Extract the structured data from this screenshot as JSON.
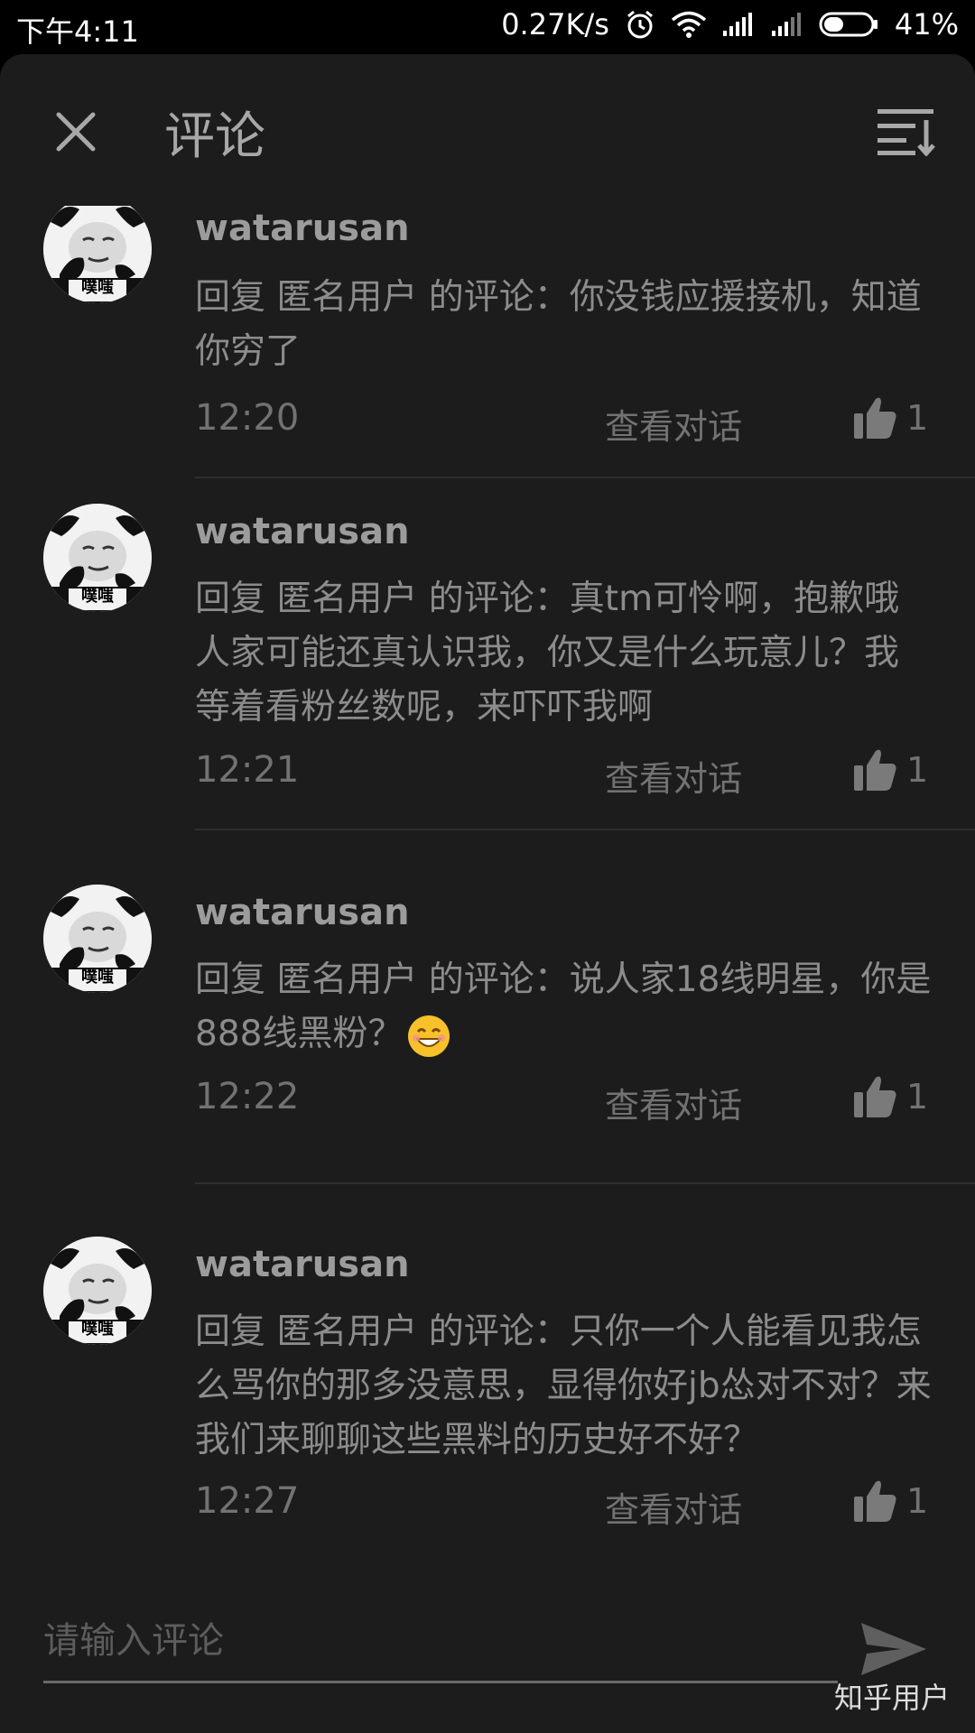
{
  "status_bar": {
    "time": "下午4:11",
    "network_speed": "0.27K/s",
    "battery_percent": "41%",
    "battery_level": 0.41,
    "icons": [
      "alarm-icon",
      "wifi-icon",
      "signal-icon",
      "signal-icon-2",
      "battery-icon"
    ]
  },
  "header": {
    "title": "评论",
    "close_icon": "close-icon",
    "sort_icon": "sort-icon"
  },
  "comments": [
    {
      "username": "watarusan",
      "avatar_caption": "噗嗤",
      "text": "回复 匿名用户 的评论：你没钱应援接机，知道你穷了",
      "time": "12:20",
      "view_conversation": "查看对话",
      "likes": "1"
    },
    {
      "username": "watarusan",
      "avatar_caption": "噗嗤",
      "text": "回复 匿名用户 的评论：真tm可怜啊，抱歉哦人家可能还真认识我，你又是什么玩意儿？我等着看粉丝数呢，来吓吓我啊",
      "time": "12:21",
      "view_conversation": "查看对话",
      "likes": "1"
    },
    {
      "username": "watarusan",
      "avatar_caption": "噗嗤",
      "text": "回复 匿名用户 的评论：说人家18线明星，你是888线黑粉？",
      "has_emoji": true,
      "time": "12:22",
      "view_conversation": "查看对话",
      "likes": "1"
    },
    {
      "username": "watarusan",
      "avatar_caption": "噗嗤",
      "text": "回复 匿名用户 的评论：只你一个人能看见我怎么骂你的那多没意思，显得你好jb怂对不对？来我们来聊聊这些黑料的历史好不好？",
      "time": "12:27",
      "view_conversation": "查看对话",
      "likes": "1"
    }
  ],
  "input": {
    "placeholder": "请输入评论",
    "send_icon": "send-icon"
  },
  "watermark": "知乎用户",
  "colors": {
    "background": "#1c1c1c",
    "status_bar": "#000000",
    "text_primary": "#9c9c9c",
    "text_secondary": "#727272"
  }
}
